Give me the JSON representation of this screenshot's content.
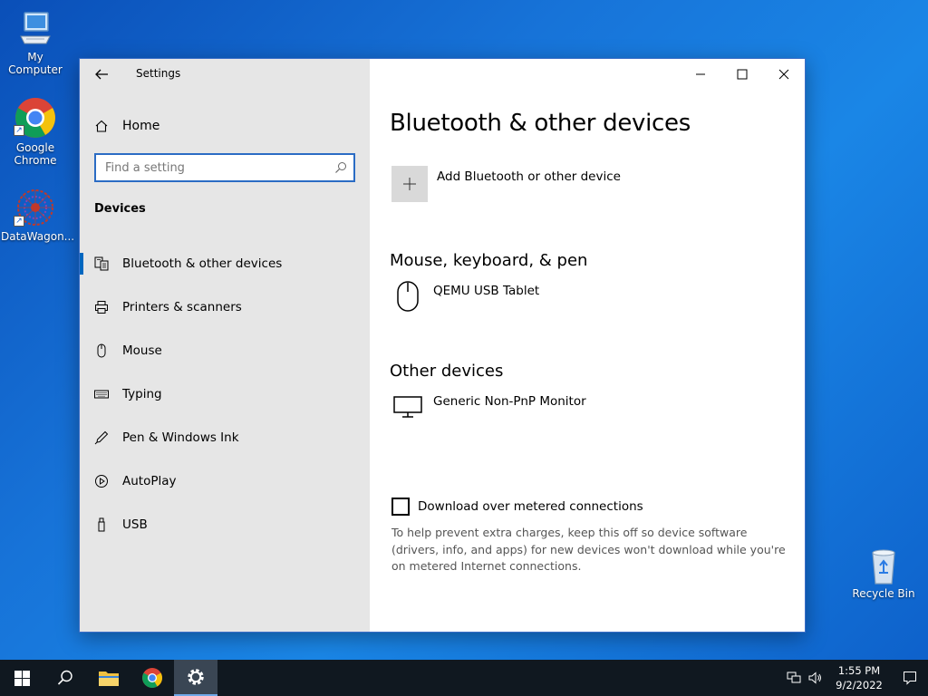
{
  "desktop": {
    "icons": [
      {
        "label": "My Computer"
      },
      {
        "label": "Google Chrome"
      },
      {
        "label": "DataWagon..."
      },
      {
        "label": "Recycle Bin"
      }
    ]
  },
  "window": {
    "app_title": "Settings",
    "sidebar": {
      "home_label": "Home",
      "search_placeholder": "Find a setting",
      "section_heading": "Devices",
      "items": [
        {
          "label": "Bluetooth & other devices",
          "icon": "bluetooth-devices-icon",
          "active": true
        },
        {
          "label": "Printers & scanners",
          "icon": "printer-icon"
        },
        {
          "label": "Mouse",
          "icon": "mouse-icon"
        },
        {
          "label": "Typing",
          "icon": "keyboard-icon"
        },
        {
          "label": "Pen & Windows Ink",
          "icon": "pen-icon"
        },
        {
          "label": "AutoPlay",
          "icon": "autoplay-icon"
        },
        {
          "label": "USB",
          "icon": "usb-icon"
        }
      ]
    },
    "content": {
      "page_title": "Bluetooth & other devices",
      "add_device_label": "Add Bluetooth or other device",
      "groups": [
        {
          "title": "Mouse, keyboard, & pen",
          "devices": [
            {
              "name": "QEMU USB Tablet",
              "icon": "mouse-icon"
            }
          ]
        },
        {
          "title": "Other devices",
          "devices": [
            {
              "name": "Generic Non-PnP Monitor",
              "icon": "monitor-icon"
            }
          ]
        }
      ],
      "metered_label": "Download over metered connections",
      "metered_checked": false,
      "metered_description": "To help prevent extra charges, keep this off so device software (drivers, info, and apps) for new devices won't download while you're on metered Internet connections."
    }
  },
  "taskbar": {
    "time": "1:55 PM",
    "date": "9/2/2022"
  },
  "colors": {
    "accent": "#0067c0",
    "sidebar_bg": "#e6e6e6",
    "taskbar_bg": "#101820"
  }
}
